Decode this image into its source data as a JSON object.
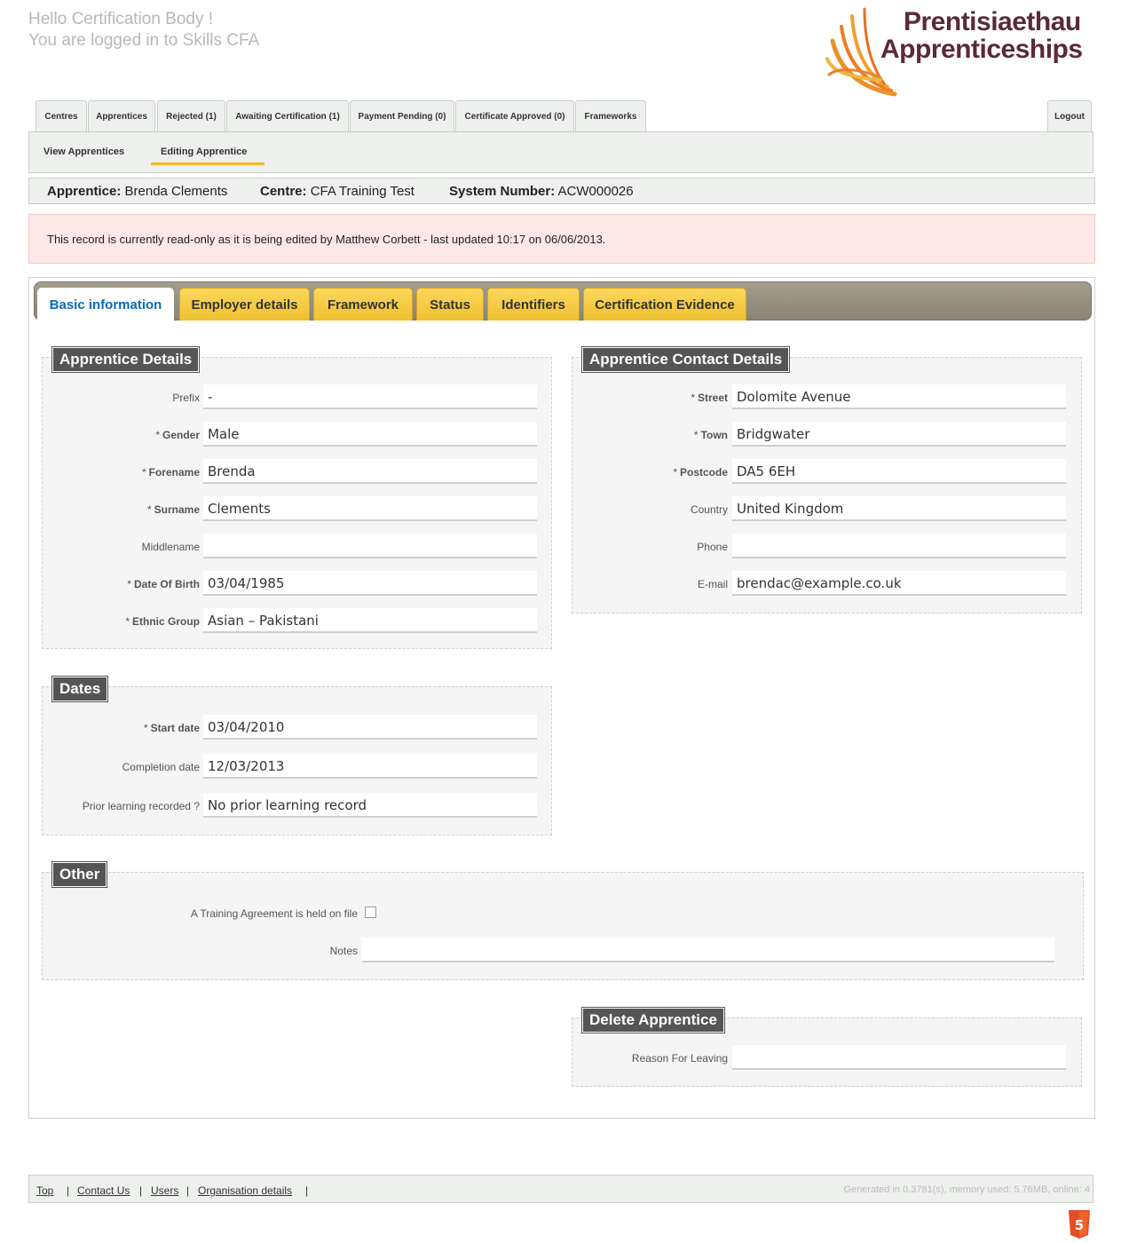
{
  "header": {
    "greeting": "Hello Certification Body !",
    "logged_in": "You are logged in to Skills CFA",
    "logo_line1": "Prentisiaethau",
    "logo_line2": "Apprenticeships"
  },
  "topnav": {
    "tabs": [
      "Centres",
      "Apprentices",
      "Rejected (1)",
      "Awaiting Certification (1)",
      "Payment Pending (0)",
      "Certificate Approved (0)",
      "Frameworks"
    ],
    "logout": "Logout"
  },
  "subnav": {
    "items": [
      "View Apprentices",
      "Editing Apprentice"
    ]
  },
  "infobar": {
    "apprentice_label": "Apprentice:",
    "apprentice_value": "Brenda Clements",
    "centre_label": "Centre:",
    "centre_value": "CFA Training Test",
    "sysnum_label": "System Number:",
    "sysnum_value": "ACW000026"
  },
  "alert": "This record is currently read-only as it is being edited by Matthew Corbett - last updated 10:17 on 06/06/2013.",
  "tabs": [
    "Basic information",
    "Employer details",
    "Framework",
    "Status",
    "Identifiers",
    "Certification Evidence"
  ],
  "apprentice_details": {
    "title": "Apprentice Details",
    "fields": [
      {
        "label": "Prefix",
        "required": "",
        "value": "-"
      },
      {
        "label": "Gender",
        "required": "*",
        "value": "Male"
      },
      {
        "label": "Forename",
        "required": "*",
        "value": "Brenda"
      },
      {
        "label": "Surname",
        "required": "*",
        "value": "Clements"
      },
      {
        "label": "Middlename",
        "required": "",
        "value": ""
      },
      {
        "label": "Date Of Birth",
        "required": "*",
        "value": "03/04/1985"
      },
      {
        "label": "Ethnic Group",
        "required": "*",
        "value": "Asian – Pakistani"
      }
    ]
  },
  "contact_details": {
    "title": "Apprentice Contact Details",
    "fields": [
      {
        "label": "Street",
        "required": "*",
        "value": "Dolomite Avenue"
      },
      {
        "label": "Town",
        "required": "*",
        "value": "Bridgwater"
      },
      {
        "label": "Postcode",
        "required": "*",
        "value": "DA5 6EH"
      },
      {
        "label": "Country",
        "required": "",
        "value": "United Kingdom"
      },
      {
        "label": "Phone",
        "required": "",
        "value": ""
      },
      {
        "label": "E-mail",
        "required": "",
        "value": "brendac@example.co.uk"
      }
    ]
  },
  "dates": {
    "title": "Dates",
    "fields": [
      {
        "label": "Start date",
        "required": "*",
        "value": "03/04/2010"
      },
      {
        "label": "Completion date",
        "required": "",
        "value": "12/03/2013"
      },
      {
        "label": "Prior learning recorded ?",
        "required": "",
        "value": "No prior learning record"
      }
    ]
  },
  "other": {
    "title": "Other",
    "training_agreement_label": "A Training Agreement is held on file",
    "training_agreement_checked": false,
    "notes_label": "Notes",
    "notes_value": ""
  },
  "delete_apprentice": {
    "title": "Delete Apprentice",
    "reason_label": "Reason For Leaving",
    "reason_value": ""
  },
  "footer": {
    "links": [
      "Top",
      "Contact Us",
      "Users",
      "Organisation details"
    ],
    "generated": "Generated in 0.3781(s), memory used: 5.76MB, online: 4"
  },
  "colors": {
    "tab_yellow": "#f3c234",
    "active_tab_text": "#0a6ab5",
    "alert_bg": "#fde7e7",
    "legend_bg": "#555555"
  },
  "icons": {
    "logo_mark": "sunburst-logo-icon",
    "html5": "html5-icon"
  }
}
